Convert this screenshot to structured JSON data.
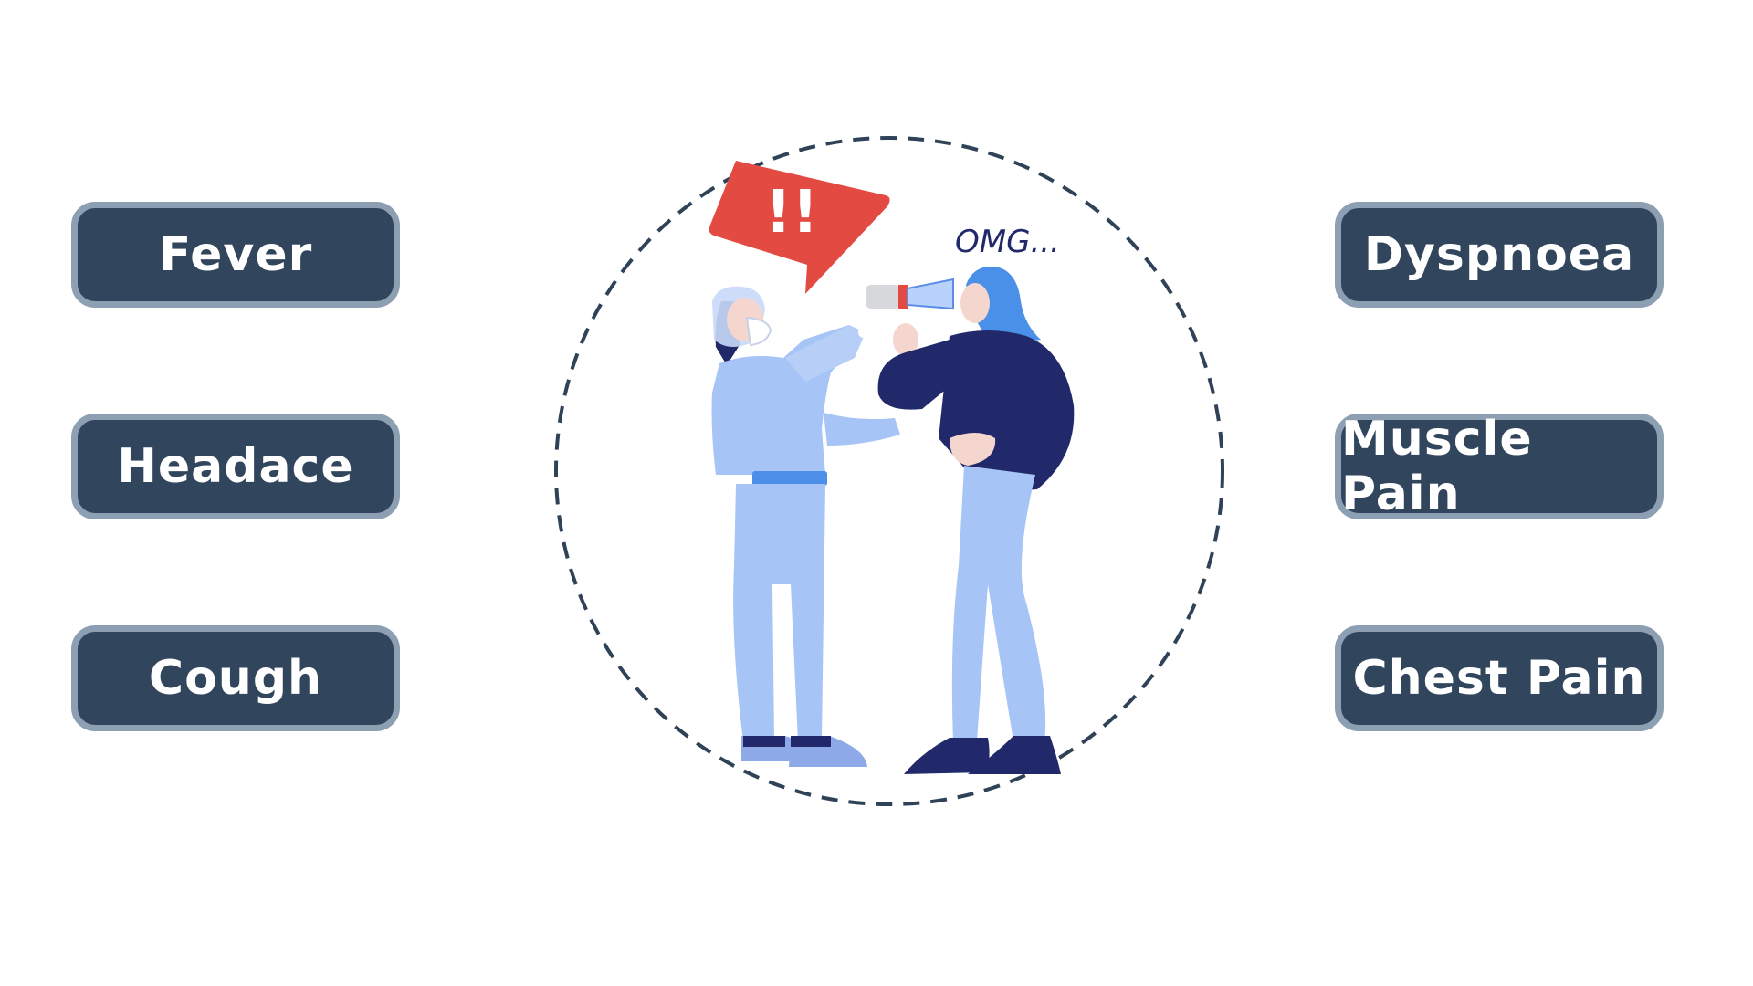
{
  "symptoms": {
    "left": [
      "Fever",
      "Headace",
      "Cough"
    ],
    "right": [
      "Dyspnoea",
      "Muscle Pain",
      "Chest Pain"
    ]
  },
  "illustration": {
    "speech_bubble": "!!",
    "exclamation": "OMG..."
  },
  "colors": {
    "pill_fill": "#31465d",
    "pill_border": "#8d9fb3",
    "circle_stroke": "#2f4257",
    "alert_red": "#e34a42",
    "suit_light_blue": "#a6c4f6",
    "navy": "#22296a"
  }
}
